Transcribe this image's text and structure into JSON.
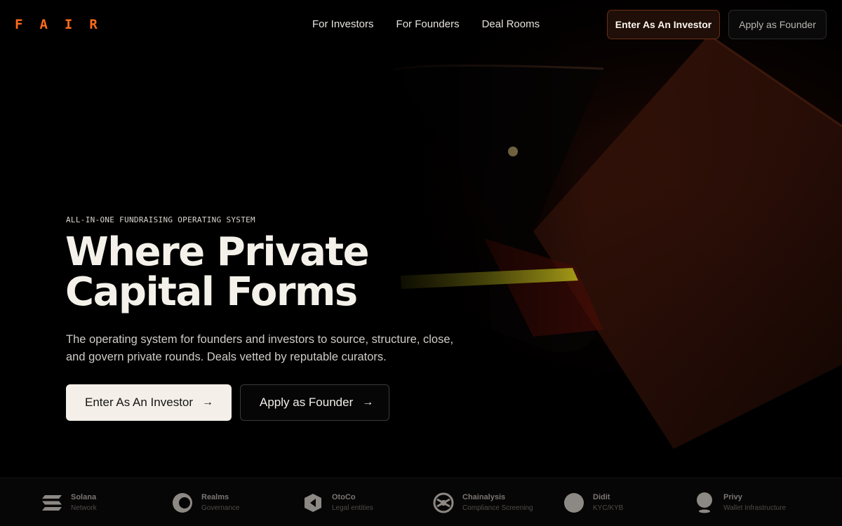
{
  "brand": {
    "logo": "FAIR",
    "accent": "#ff6b1a"
  },
  "nav": {
    "links": [
      "For Investors",
      "For Founders",
      "Deal Rooms"
    ],
    "investor_button": "Enter As An Investor",
    "founder_button": "Apply as Founder"
  },
  "hero": {
    "eyebrow": "ALL-IN-ONE FUNDRAISING OPERATING SYSTEM",
    "title_line1": "Where Private",
    "title_line2": "Capital Forms",
    "description": "The operating system for founders and investors to source, structure, close, and govern private rounds. Deals vetted by reputable curators.",
    "cta_investor": "Enter As An Investor",
    "cta_founder": "Apply as Founder",
    "arrow": "→"
  },
  "partners": [
    {
      "name": "Solana",
      "sub": "Network",
      "icon": "solana-icon"
    },
    {
      "name": "Realms",
      "sub": "Governance",
      "icon": "realms-icon"
    },
    {
      "name": "OtoCo",
      "sub": "Legal entities",
      "icon": "otoco-icon"
    },
    {
      "name": "Chainalysis",
      "sub": "Compliance Screening",
      "icon": "chainalysis-icon"
    },
    {
      "name": "Didit",
      "sub": "KYC/KYB",
      "icon": "didit-icon"
    },
    {
      "name": "Privy",
      "sub": "Wallet Infrastructure",
      "icon": "privy-icon"
    }
  ]
}
